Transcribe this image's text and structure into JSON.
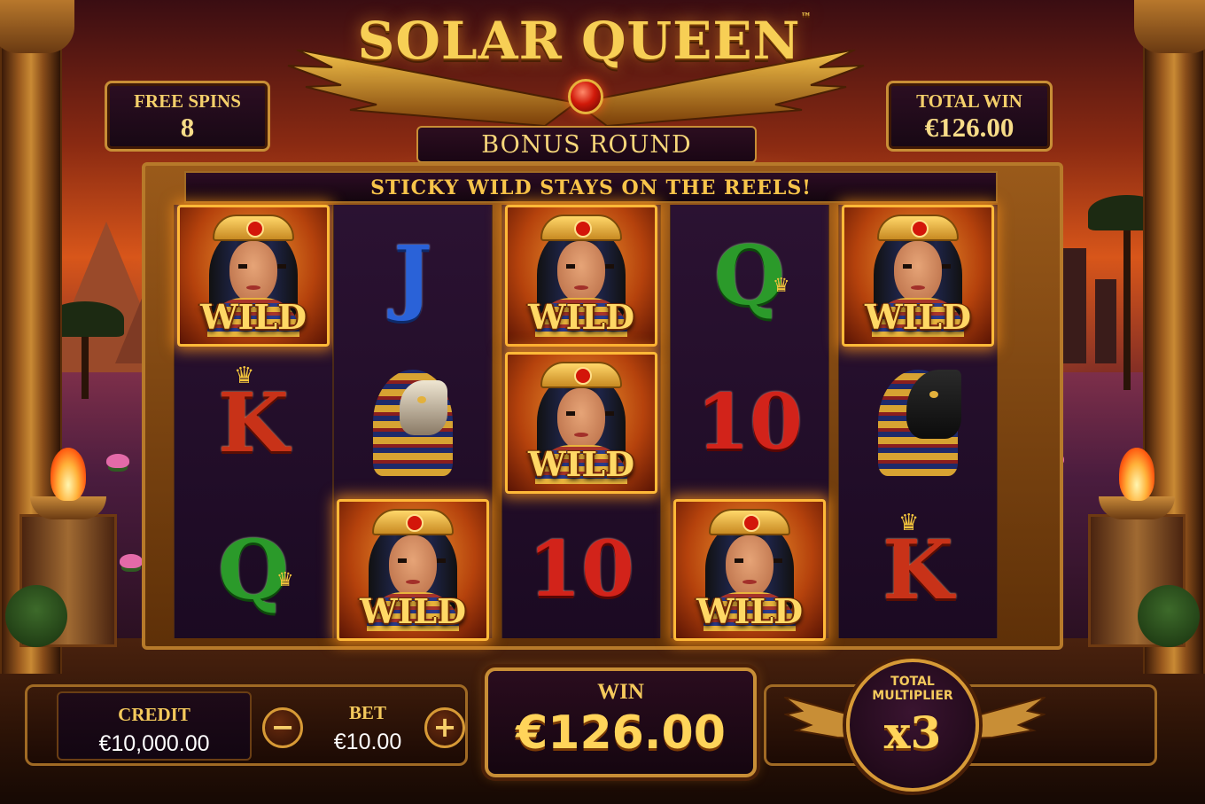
{
  "game": {
    "title": "SOLAR QUEEN",
    "trademark": "™",
    "round_label": "BONUS ROUND",
    "banner": "STICKY WILD STAYS ON THE REELS!"
  },
  "free_spins": {
    "label": "FREE SPINS",
    "value": "8"
  },
  "total_win": {
    "label": "TOTAL WIN",
    "value": "€126.00"
  },
  "reels": [
    [
      "wild",
      "K",
      "Q"
    ],
    [
      "J",
      "falcon",
      "wild"
    ],
    [
      "wild",
      "wild",
      "10"
    ],
    [
      "Q",
      "10",
      "wild"
    ],
    [
      "wild",
      "jackal",
      "K"
    ]
  ],
  "symbols": {
    "wild_label": "WILD",
    "J": "J",
    "Q": "Q",
    "K": "K",
    "ten": "10"
  },
  "credit": {
    "label": "CREDIT",
    "value": "€10,000.00"
  },
  "bet": {
    "label": "BET",
    "value": "€10.00",
    "minus": "−",
    "plus": "+"
  },
  "win": {
    "label": "WIN",
    "value": "€126.00"
  },
  "multiplier": {
    "label": "TOTAL\nMULTIPLIER",
    "value": "x3"
  },
  "colors": {
    "gold": "#f7cf55",
    "wild_glow": "#ffb938",
    "panel": "#1b0a22"
  }
}
